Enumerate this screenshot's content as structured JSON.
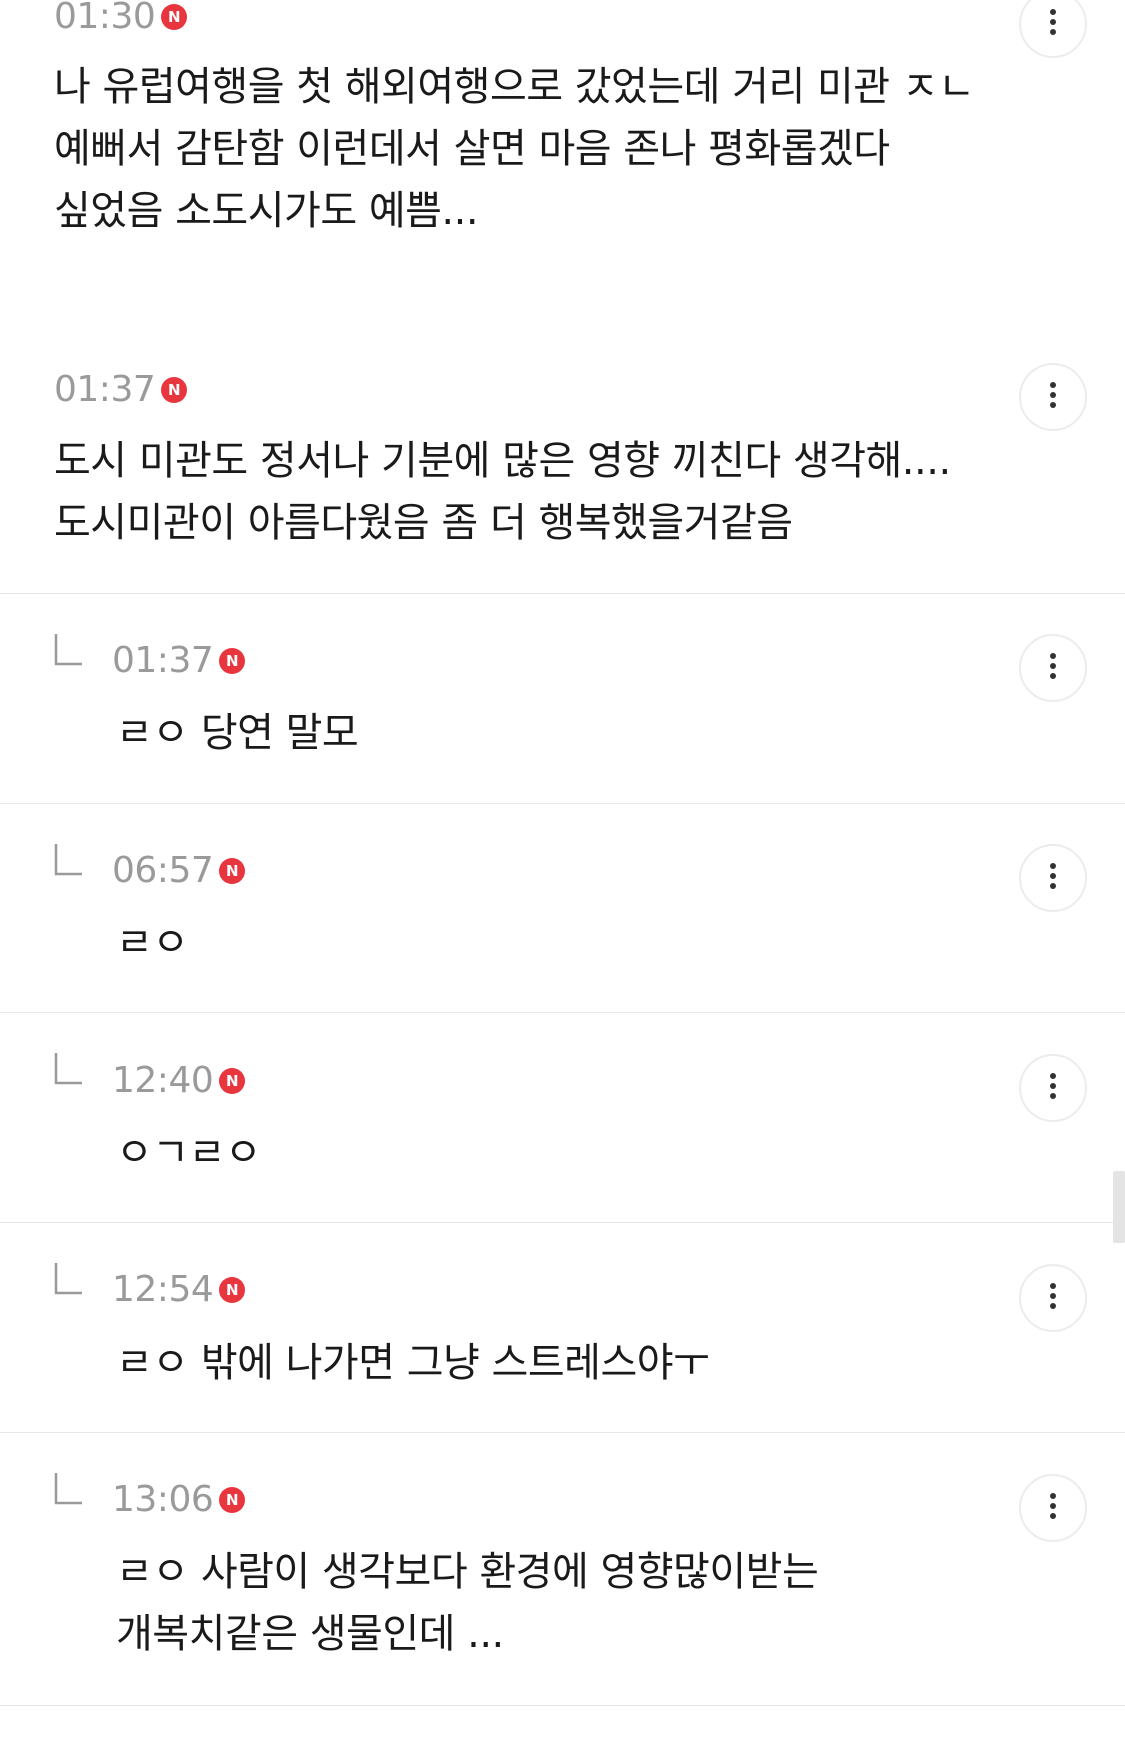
{
  "colors": {
    "badge": "#e8363f",
    "time": "#9a9a9a",
    "text": "#1a1a1a",
    "divider": "#e8e8e8"
  },
  "comments": [
    {
      "time": "01:30",
      "badge": "N",
      "is_reply": false,
      "text": "나 유럽여행을 첫 해외여행으로 갔었는데 거리 미관 ㅈㄴ\n예뻐서 감탄함 이런데서 살면 마음 존나 평화롭겠다\n싶었음 소도시가도 예쁨..."
    },
    {
      "time": "01:37",
      "badge": "N",
      "is_reply": false,
      "text": "도시 미관도 정서나 기분에 많은 영향 끼친다 생각해....\n도시미관이 아름다웠음 좀 더 행복했을거같음"
    },
    {
      "time": "01:37",
      "badge": "N",
      "is_reply": true,
      "text": "ㄹㅇ 당연 말모"
    },
    {
      "time": "06:57",
      "badge": "N",
      "is_reply": true,
      "text": "ㄹㅇ"
    },
    {
      "time": "12:40",
      "badge": "N",
      "is_reply": true,
      "text": "ㅇㄱㄹㅇ"
    },
    {
      "time": "12:54",
      "badge": "N",
      "is_reply": true,
      "text": "ㄹㅇ 밖에 나가면 그냥 스트레스야ㅜ"
    },
    {
      "time": "13:06",
      "badge": "N",
      "is_reply": true,
      "text": "ㄹㅇ 사람이 생각보다 환경에 영향많이받는\n개복치같은 생물인데 ..."
    }
  ],
  "icons": {
    "more": "more-vertical-icon",
    "reply": "reply-arrow-icon"
  }
}
